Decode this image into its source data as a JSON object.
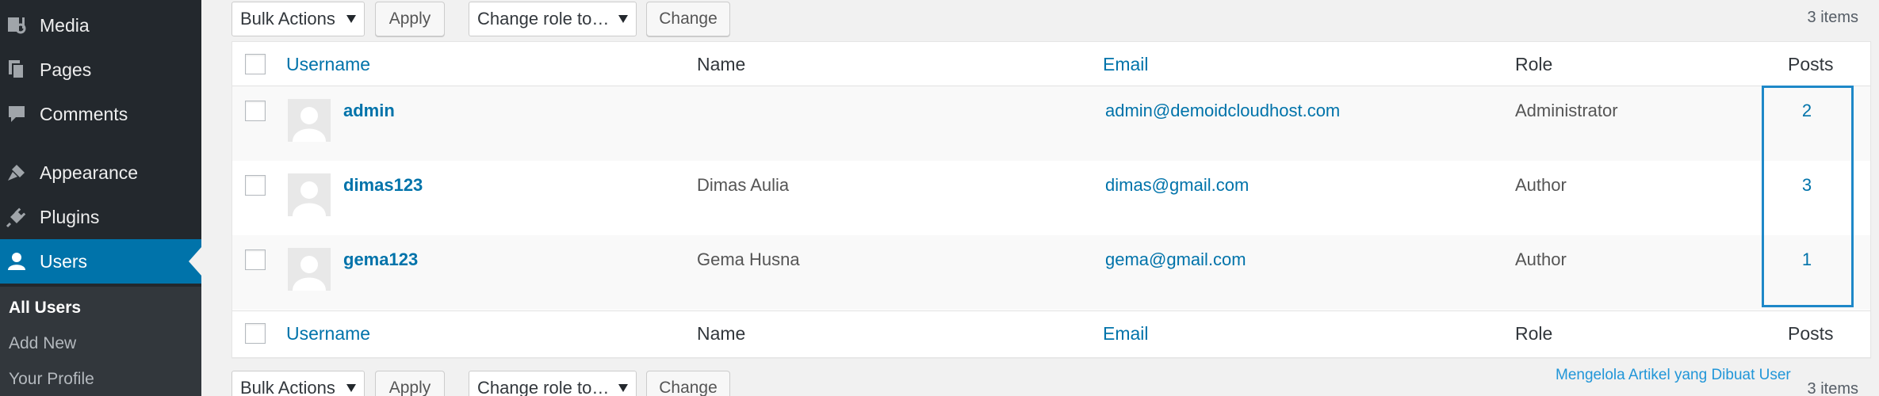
{
  "sidebar": {
    "items": [
      {
        "label": "Media",
        "icon": "media-icon"
      },
      {
        "label": "Pages",
        "icon": "pages-icon"
      },
      {
        "label": "Comments",
        "icon": "comments-icon"
      },
      {
        "label": "Appearance",
        "icon": "appearance-icon"
      },
      {
        "label": "Plugins",
        "icon": "plugins-icon"
      },
      {
        "label": "Users",
        "icon": "users-icon",
        "active": true
      }
    ],
    "submenu": [
      "All Users",
      "Add New",
      "Your Profile"
    ]
  },
  "toolbar": {
    "bulk_actions": "Bulk Actions",
    "apply": "Apply",
    "change_role": "Change role to…",
    "change": "Change",
    "items_count": "3 items"
  },
  "table": {
    "headers": {
      "username": "Username",
      "name": "Name",
      "email": "Email",
      "role": "Role",
      "posts": "Posts"
    },
    "rows": [
      {
        "username": "admin",
        "name": "",
        "email": "admin@demoidcloudhost.com",
        "role": "Administrator",
        "posts": "2"
      },
      {
        "username": "dimas123",
        "name": "Dimas Aulia",
        "email": "dimas@gmail.com",
        "role": "Author",
        "posts": "3"
      },
      {
        "username": "gema123",
        "name": "Gema Husna",
        "email": "gema@gmail.com",
        "role": "Author",
        "posts": "1"
      }
    ]
  },
  "annotation": {
    "caption": "Mengelola Artikel yang Dibuat User",
    "color": "#1e88c8"
  },
  "colors": {
    "accent": "#0073aa",
    "sidebar": "#23282d"
  }
}
